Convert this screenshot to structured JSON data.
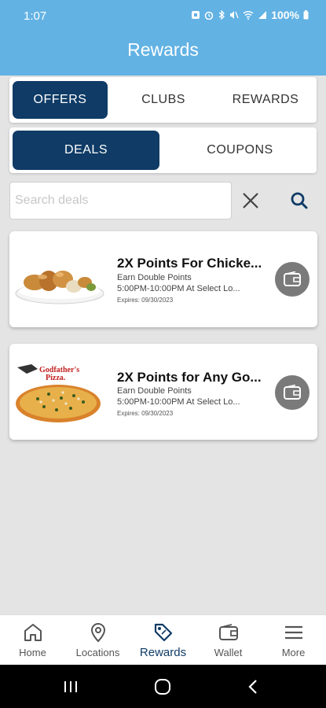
{
  "status_bar": {
    "time": "1:07",
    "battery": "100%"
  },
  "header": {
    "title": "Rewards"
  },
  "main_tabs": [
    {
      "label": "OFFERS",
      "active": true
    },
    {
      "label": "CLUBS",
      "active": false
    },
    {
      "label": "REWARDS",
      "active": false
    }
  ],
  "sub_tabs": [
    {
      "label": "DEALS",
      "active": true
    },
    {
      "label": "COUPONS",
      "active": false
    }
  ],
  "search": {
    "placeholder": "Search deals",
    "value": ""
  },
  "deals": [
    {
      "title": "2X Points For Chicke...",
      "line1": "Earn Double Points",
      "line2": "5:00PM-10:00PM At Select Lo...",
      "expires": "Expires: 09/30/2023",
      "image": "chicken-plate"
    },
    {
      "title": "2X Points for Any Go...",
      "line1": "Earn Double Points",
      "line2": "5:00PM-10:00PM At Select Lo...",
      "expires": "Expires: 09/30/2023",
      "image": "godfathers-pizza",
      "logo_text_1": "Godfather's",
      "logo_text_2": "Pizza."
    }
  ],
  "bottom_nav": [
    {
      "label": "Home",
      "icon": "home-icon",
      "active": false
    },
    {
      "label": "Locations",
      "icon": "location-pin-icon",
      "active": false
    },
    {
      "label": "Rewards",
      "icon": "tag-icon",
      "active": true
    },
    {
      "label": "Wallet",
      "icon": "wallet-icon",
      "active": false
    },
    {
      "label": "More",
      "icon": "menu-icon",
      "active": false
    }
  ],
  "colors": {
    "header": "#62b2e4",
    "accent": "#0f3b66",
    "background": "#e4e4e4"
  }
}
